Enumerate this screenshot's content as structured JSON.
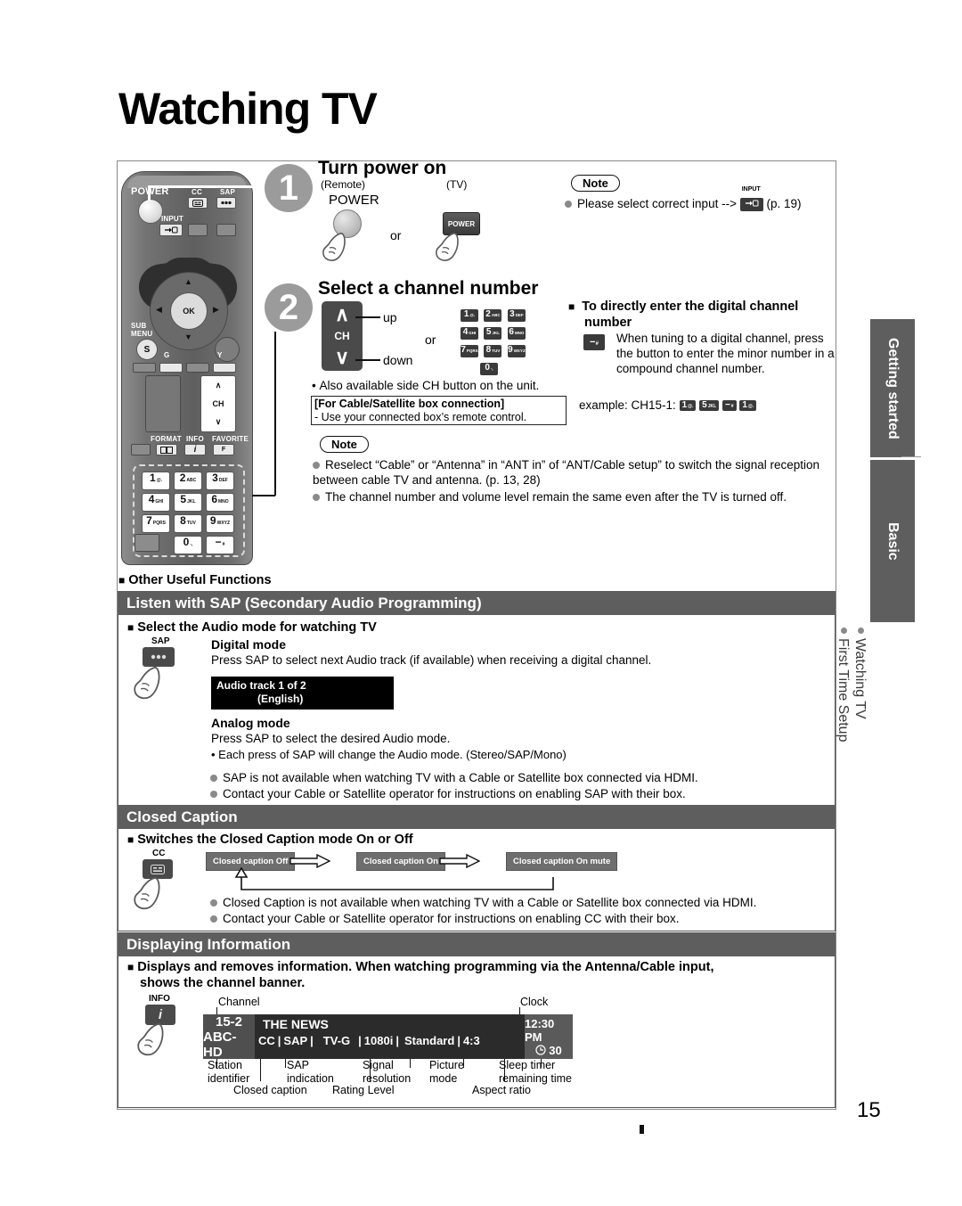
{
  "page": {
    "title": "Watching TV",
    "number": "15"
  },
  "step1": {
    "num": "1",
    "heading": "Turn power on",
    "remote_label": "(Remote)",
    "tv_label": "(TV)",
    "power_label": "POWER",
    "or": "or",
    "tv_button": "POWER"
  },
  "step1_note": {
    "title": "Note",
    "text_before": "Please select correct input -->",
    "chip_label": "INPUT",
    "text_after": "(p. 19)"
  },
  "step2": {
    "num": "2",
    "heading": "Select a channel number",
    "ch_label": "CH",
    "up": "up",
    "down": "down",
    "or": "or",
    "keypad": [
      {
        "d": "1",
        "s": "@."
      },
      {
        "d": "2",
        "s": "ABC"
      },
      {
        "d": "3",
        "s": "DEF"
      },
      {
        "d": "4",
        "s": "GHI"
      },
      {
        "d": "5",
        "s": "JKL"
      },
      {
        "d": "6",
        "s": "MNO"
      },
      {
        "d": "7",
        "s": "PQRS"
      },
      {
        "d": "8",
        "s": "TUV"
      },
      {
        "d": "9",
        "s": "WXYZ"
      },
      {
        "d": "0",
        "s": "-,"
      }
    ],
    "side_note": "Also available side CH button on the unit.",
    "cable_box_line1": "[For Cable/Satellite box connection]",
    "cable_box_line2": "- Use your connected box’s remote control."
  },
  "digital_channel": {
    "heading_line1": "To directly enter the digital channel",
    "heading_line2": "number",
    "body": "When tuning to a digital channel, press the button to enter the minor number in a compound channel number.",
    "example_label": "example:  CH15-1:",
    "example_keys": [
      "1",
      "5",
      "−",
      "1"
    ],
    "example_keys_sub": [
      "@.",
      "JKL",
      "#",
      "@."
    ]
  },
  "step2_note": {
    "title": "Note",
    "items": [
      "Reselect “Cable” or “Antenna” in “ANT in” of “ANT/Cable setup” to switch the signal reception between cable TV and antenna. (p. 13, 28)",
      "The channel number and volume level remain the same even after the TV is turned off."
    ]
  },
  "other_useful_functions": {
    "label": "Other Useful Functions"
  },
  "sap": {
    "bar_title": "Listen with SAP (Secondary Audio Programming)",
    "sub_heading": "Select the Audio mode for watching TV",
    "key_label": "SAP",
    "digital_mode_title": "Digital mode",
    "digital_mode_text": "Press SAP to select next Audio track (if available) when receiving a digital channel.",
    "osd_line1": "Audio track 1 of 2",
    "osd_line2": "(English)",
    "analog_mode_title": "Analog mode",
    "analog_mode_text": "Press SAP to select the desired Audio mode.",
    "analog_mode_bullet": "Each press of SAP will change the Audio mode. (Stereo/SAP/Mono)",
    "notes": [
      "SAP is not available when watching TV with a Cable or Satellite box connected via HDMI.",
      "Contact your Cable or Satellite operator for instructions on enabling SAP with their box."
    ]
  },
  "closed_caption": {
    "bar_title": "Closed Caption",
    "sub_heading": "Switches the Closed Caption mode On or Off",
    "key_label": "CC",
    "states": [
      "Closed caption Off",
      "Closed caption On",
      "Closed caption On mute"
    ],
    "notes": [
      "Closed Caption is not available when watching TV with a Cable or Satellite box connected via HDMI.",
      "Contact your Cable or Satellite operator for instructions on enabling CC with their box."
    ]
  },
  "displaying_information": {
    "bar_title": "Displaying Information",
    "sub_heading_line1": "Displays and removes information. When watching programming via the Antenna/Cable input,",
    "sub_heading_line2": "shows the channel banner.",
    "key_label": "INFO",
    "callout_channel": "Channel",
    "callout_clock": "Clock",
    "banner": {
      "channel_number": "15-2",
      "station": "ABC-HD",
      "program": "THE NEWS",
      "cc": "CC",
      "sap": "SAP",
      "rating": "TV-G",
      "resolution": "1080i",
      "picture_mode": "Standard",
      "aspect": "4:3",
      "clock": "12:30 PM",
      "sleep": "30"
    },
    "callouts": [
      {
        "line1": "Station",
        "line2": "identifier"
      },
      {
        "line1": "SAP",
        "line2": "indication"
      },
      {
        "line1": "Signal",
        "line2": "resolution"
      },
      {
        "line1": "Picture",
        "line2": "mode"
      },
      {
        "line1": "Sleep timer",
        "line2": "remaining time"
      }
    ],
    "callouts_lower": [
      "Closed caption",
      "Rating Level",
      "Aspect ratio"
    ]
  },
  "sidebar": {
    "tabs": [
      {
        "label": "Getting started"
      },
      {
        "label": "Basic"
      }
    ],
    "links": [
      {
        "label": "Watching TV"
      },
      {
        "label": "First Time Setup"
      }
    ]
  },
  "remote": {
    "power": "POWER",
    "cc": "CC",
    "sap": "SAP",
    "input": "INPUT",
    "sub": "SUB",
    "menu": "MENU",
    "sub_menu_key": "S",
    "ok": "OK",
    "g": "G",
    "y": "Y",
    "ch": "CH",
    "format": "FORMAT",
    "info": "INFO",
    "favorite": "FAVORITE",
    "favorite_key": "F",
    "keypad": [
      {
        "d": "1",
        "s": "@."
      },
      {
        "d": "2",
        "s": "ABC"
      },
      {
        "d": "3",
        "s": "DEF"
      },
      {
        "d": "4",
        "s": "GHI"
      },
      {
        "d": "5",
        "s": "JKL"
      },
      {
        "d": "6",
        "s": "MNO"
      },
      {
        "d": "7",
        "s": "PQRS"
      },
      {
        "d": "8",
        "s": "TUV"
      },
      {
        "d": "9",
        "s": "WXYZ"
      },
      {
        "d": "0",
        "s": "-,"
      },
      {
        "d": "−",
        "s": "#"
      }
    ]
  },
  "colors": {
    "bar": "#5e5e5e",
    "step_circle": "#9b9b9b",
    "bullet": "#8a8a8a"
  }
}
